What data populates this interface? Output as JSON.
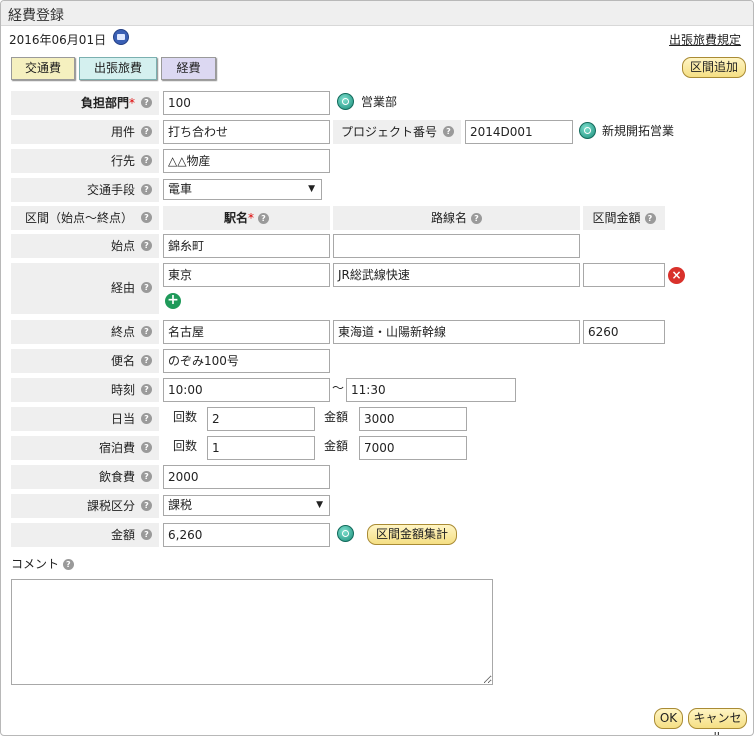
{
  "window": {
    "title": "経費登録"
  },
  "header": {
    "date": "2016年06月01日",
    "calendar_icon": "calendar-icon",
    "rule_link": "出張旅費規定"
  },
  "tabs": [
    {
      "label": "交通費"
    },
    {
      "label": "出張旅費"
    },
    {
      "label": "経費"
    }
  ],
  "buttons": {
    "add_section": "区間追加",
    "sum_amounts": "区間金額集計",
    "ok": "OK",
    "cancel": "キャンセル"
  },
  "form": {
    "dept": {
      "label": "負担部門",
      "required": "*",
      "value": "100",
      "name": "営業部"
    },
    "purpose": {
      "label": "用件",
      "value": "打ち合わせ"
    },
    "project": {
      "label": "プロジェクト番号",
      "value": "2014D001",
      "name": "新規開拓営業"
    },
    "destination": {
      "label": "行先",
      "value": "△△物産"
    },
    "transport": {
      "label": "交通手段",
      "value": "電車"
    },
    "section": {
      "label": "区間（始点～終点）",
      "col_station": "駅名",
      "col_station_required": "*",
      "col_line": "路線名",
      "col_amount": "区間金額"
    },
    "start": {
      "label": "始点",
      "station": "錦糸町",
      "line": ""
    },
    "via": {
      "label": "経由",
      "station": "東京",
      "line": "JR総武線快速",
      "amount": ""
    },
    "end": {
      "label": "終点",
      "station": "名古屋",
      "line": "東海道・山陽新幹線",
      "amount": "6260"
    },
    "flight": {
      "label": "便名",
      "value": "のぞみ100号"
    },
    "time": {
      "label": "時刻",
      "from": "10:00",
      "sep": "～",
      "to": "11:30"
    },
    "daily": {
      "label": "日当",
      "count_label": "回数",
      "count": "2",
      "amount_label": "金額",
      "amount": "3000"
    },
    "lodging": {
      "label": "宿泊費",
      "count_label": "回数",
      "count": "1",
      "amount_label": "金額",
      "amount": "7000"
    },
    "meal": {
      "label": "飲食費",
      "value": "2000"
    },
    "tax": {
      "label": "課税区分",
      "value": "課税"
    },
    "amount": {
      "label": "金額",
      "value": "6,260"
    },
    "comment": {
      "label": "コメント",
      "value": ""
    }
  },
  "help_mark": "?"
}
